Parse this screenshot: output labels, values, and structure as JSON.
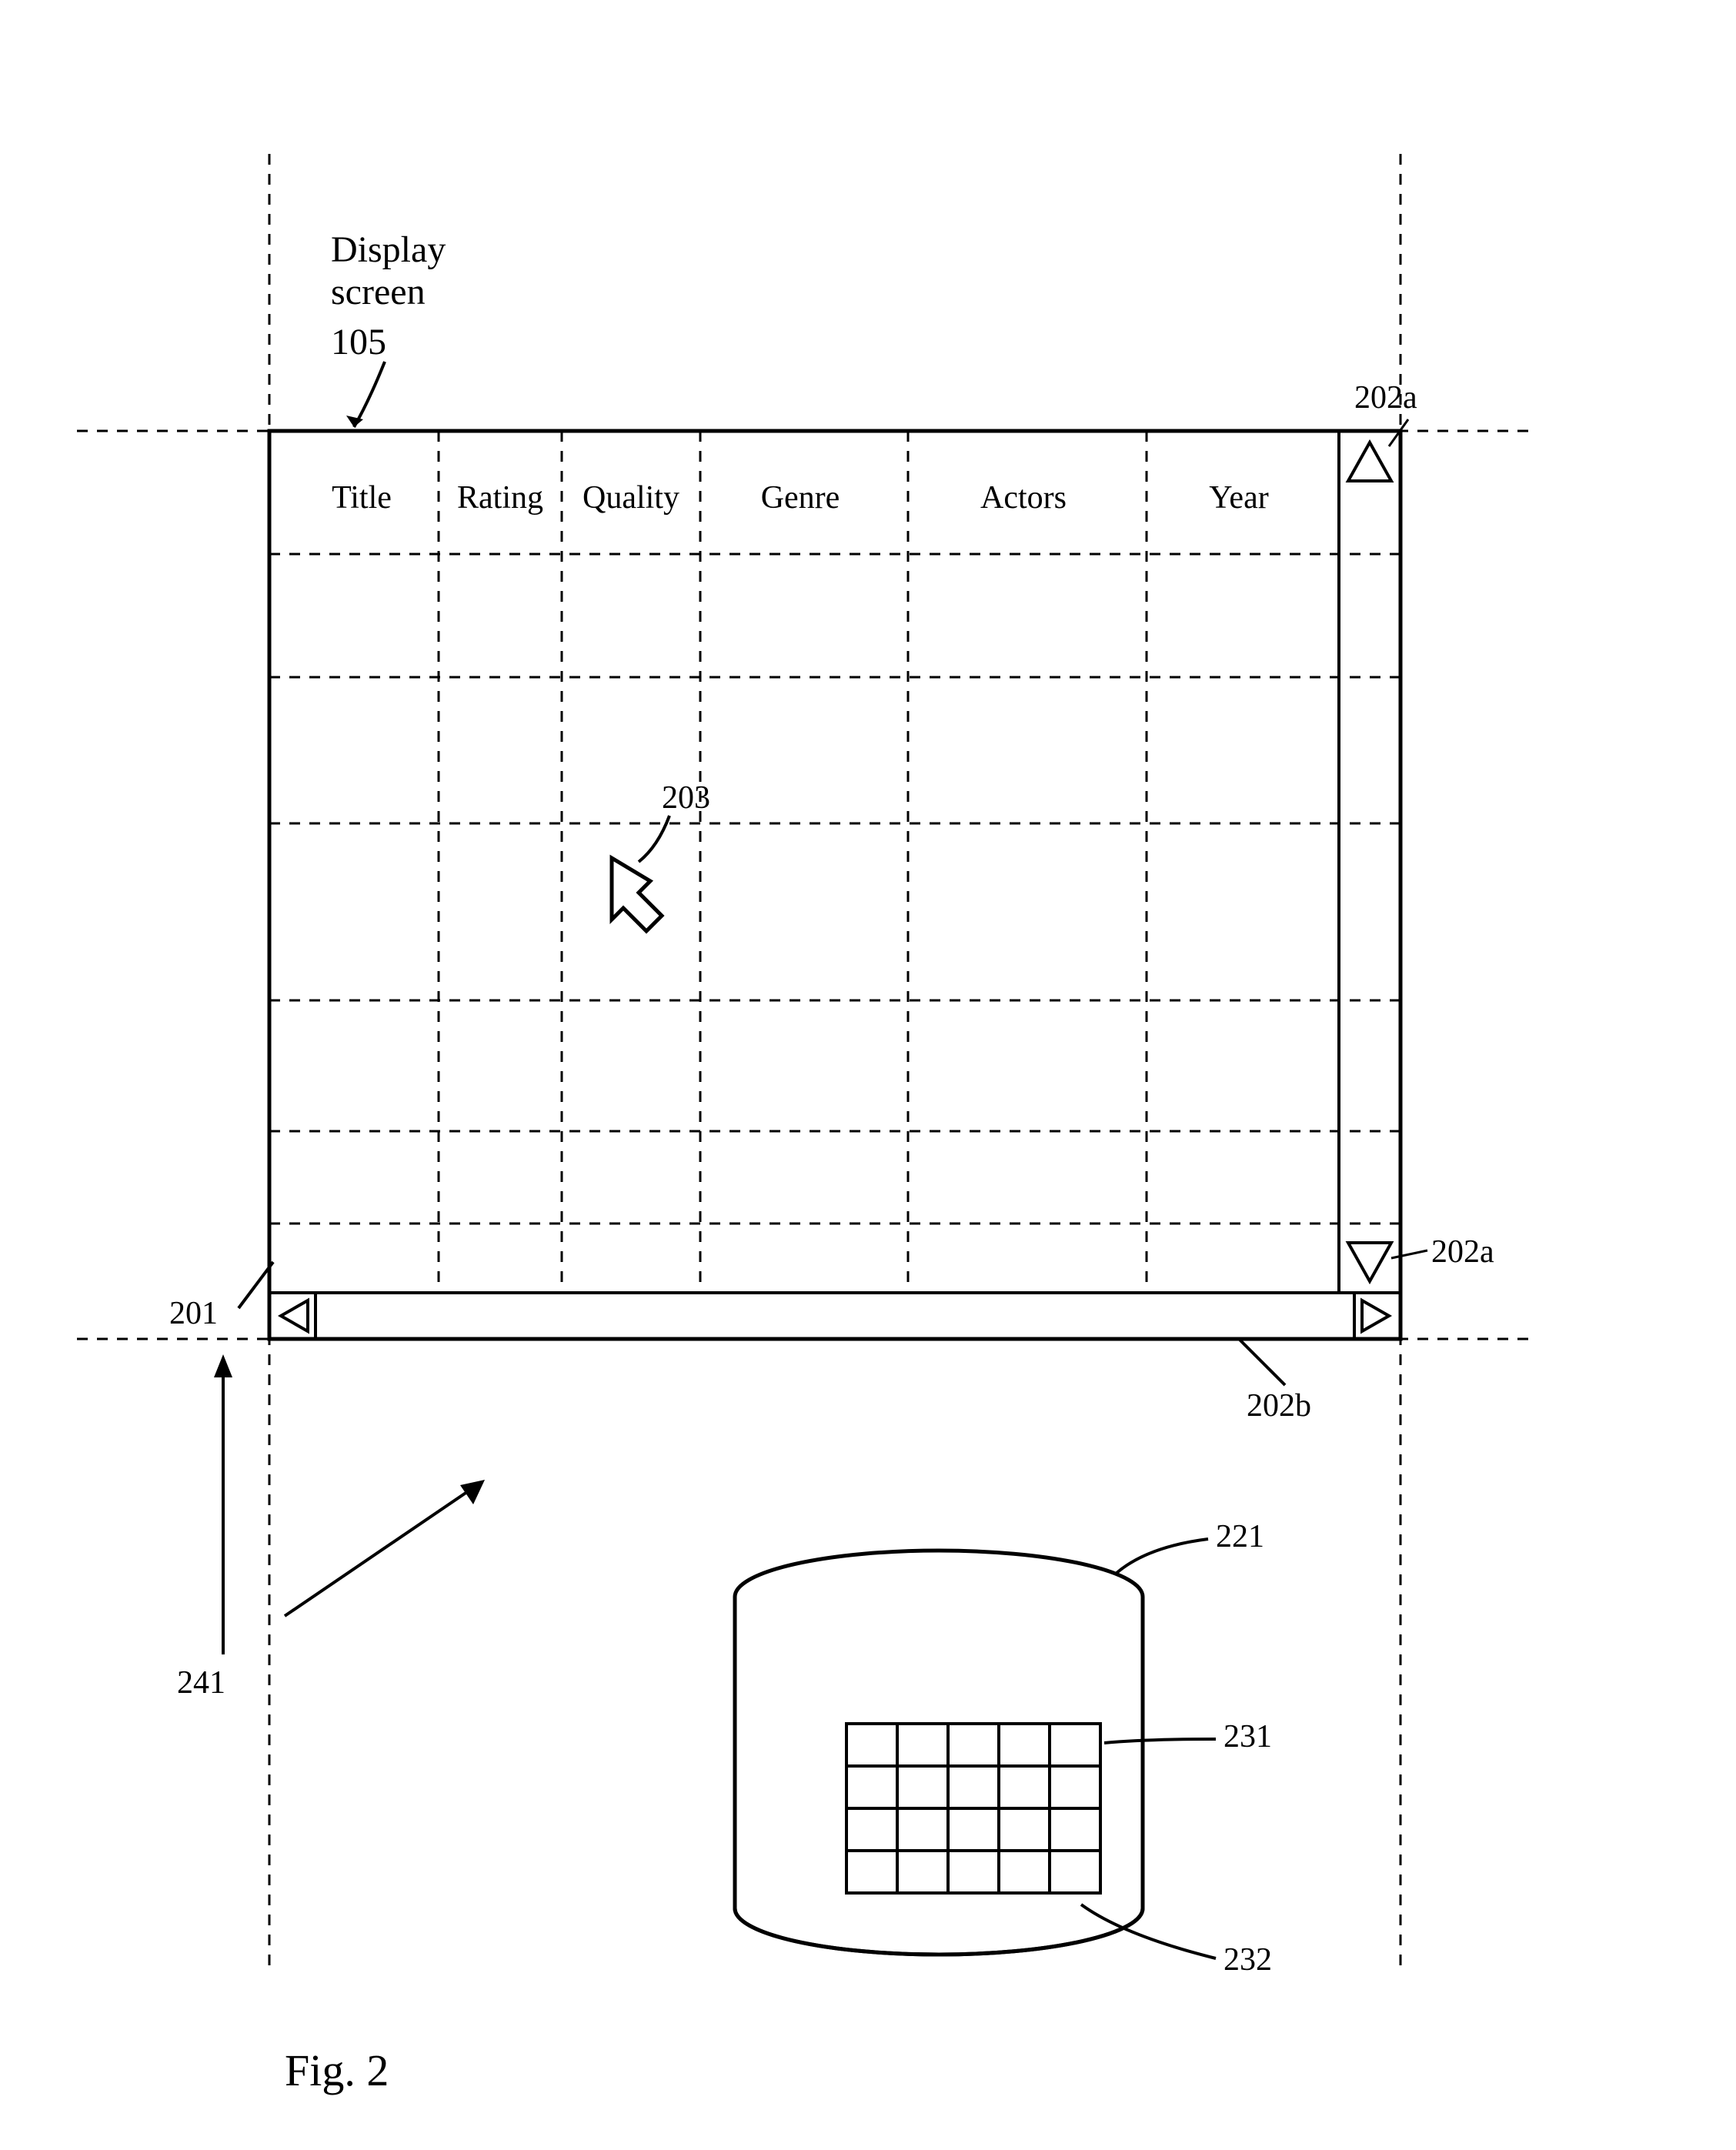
{
  "caption": "Fig. 2",
  "display_screen_label": "Display\nscreen",
  "display_screen_ref": "105",
  "columns": [
    "Title",
    "Rating",
    "Quality",
    "Genre",
    "Actors",
    "Year"
  ],
  "refs": {
    "table": "201",
    "scroll_up": "202a",
    "scroll_down": "202a",
    "scroll_h": "202b",
    "cursor": "203",
    "database": "221",
    "db_table": "231",
    "db_outline": "232",
    "angle_arrow": "241"
  }
}
